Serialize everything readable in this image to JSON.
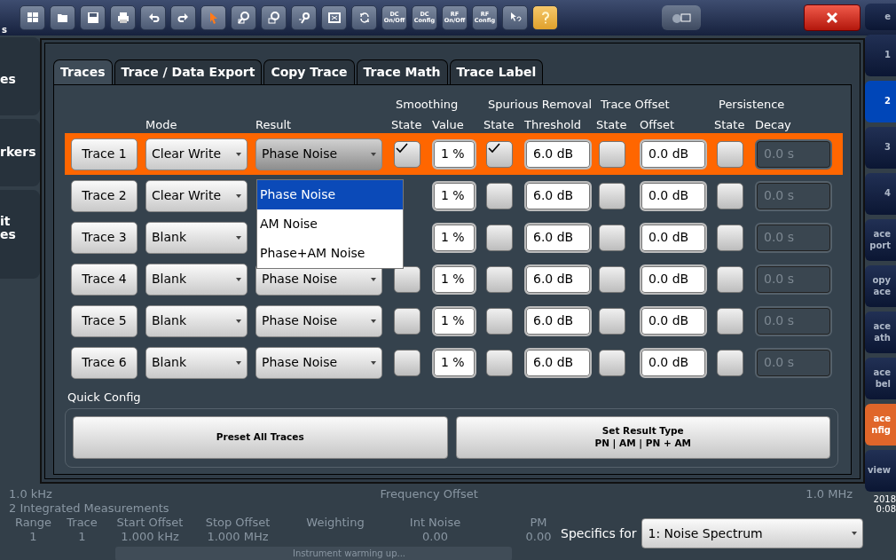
{
  "toolbar": [
    {
      "kind": "windows"
    },
    {
      "kind": "open"
    },
    {
      "kind": "save"
    },
    {
      "kind": "print"
    },
    {
      "kind": "undo"
    },
    {
      "kind": "redo"
    },
    {
      "kind": "pointer"
    },
    {
      "kind": "zoom"
    },
    {
      "kind": "multizoom"
    },
    {
      "kind": "zoomreset"
    },
    {
      "kind": "fullscreen"
    },
    {
      "kind": "split"
    },
    {
      "kind": "text",
      "lines": [
        "DC",
        "On/Off"
      ]
    },
    {
      "kind": "text",
      "lines": [
        "DC",
        "Config"
      ]
    },
    {
      "kind": "text",
      "lines": [
        "RF",
        "On/Off"
      ]
    },
    {
      "kind": "text",
      "lines": [
        "RF",
        "Config"
      ]
    },
    {
      "kind": "helppointer"
    },
    {
      "kind": "help"
    }
  ],
  "background": {
    "corner_text": "s",
    "left_tabs": [
      "es",
      "rkers",
      "it\nes"
    ],
    "softkeys": [
      {
        "label": "e",
        "selected": false
      },
      {
        "label": "1",
        "selected": false
      },
      {
        "label": "2",
        "selected": true
      },
      {
        "label": "3",
        "selected": false
      },
      {
        "label": "4",
        "selected": false
      },
      {
        "label": "ace\nport",
        "selected": false
      },
      {
        "label": "opy\nace",
        "selected": false
      },
      {
        "label": "ace\nath",
        "selected": false
      },
      {
        "label": "ace\nbel",
        "selected": false
      },
      {
        "label": "ace\nnfig",
        "selected": true
      },
      {
        "label": "view",
        "selected": false
      }
    ],
    "axis": {
      "start": "1.0 kHz",
      "title": "Frequency Offset",
      "stop": "1.0 MHz"
    },
    "table_title": "2 Integrated Measurements",
    "table_columns": [
      "Range",
      "Trace",
      "Start Offset",
      "Stop Offset",
      "Weighting",
      "Int Noise",
      "PM"
    ],
    "table_row": {
      "range": "1",
      "trace": "1",
      "start_offset": "1.000 kHz",
      "stop_offset": "1.000 MHz",
      "int_noise": "0.00",
      "pm": "0.00"
    },
    "status": "Instrument warming up...",
    "date": "2018",
    "time": "0:08"
  },
  "dialog": {
    "tabs": [
      {
        "label": "Traces",
        "selected": true
      },
      {
        "label": "Trace / Data Export",
        "selected": false
      },
      {
        "label": "Copy Trace",
        "selected": false
      },
      {
        "label": "Trace Math",
        "selected": false
      },
      {
        "label": "Trace Label",
        "selected": false
      }
    ],
    "groups": [
      "Smoothing",
      "Spurious Removal",
      "Trace Offset",
      "Persistence"
    ],
    "columns": [
      "Mode",
      "Result",
      "State",
      "Value",
      "State",
      "Threshold",
      "State",
      "Offset",
      "State",
      "Decay"
    ],
    "rows": [
      {
        "trace": "Trace 1",
        "selected": true,
        "mode": "Clear Write",
        "result": "Phase Noise",
        "smoothing": true,
        "smoothing_value": "1 %",
        "spurious": true,
        "threshold": "6.0 dB",
        "offset_on": false,
        "offset": "0.0 dB",
        "persistence": false,
        "decay": "0.0 s"
      },
      {
        "trace": "Trace 2",
        "selected": false,
        "mode": "Clear Write",
        "spurious": false,
        "smoothing_value": "1 %",
        "threshold": "6.0 dB",
        "offset_on": false,
        "offset": "0.0 dB",
        "persistence": false,
        "decay": "0.0 s"
      },
      {
        "trace": "Trace 3",
        "selected": false,
        "mode": "Blank",
        "spurious": false,
        "smoothing_value": "1 %",
        "threshold": "6.0 dB",
        "offset_on": false,
        "offset": "0.0 dB",
        "persistence": false,
        "decay": "0.0 s"
      },
      {
        "trace": "Trace 4",
        "selected": false,
        "mode": "Blank",
        "result": "Phase Noise",
        "smoothing": false,
        "smoothing_value": "1 %",
        "spurious": false,
        "threshold": "6.0 dB",
        "offset_on": false,
        "offset": "0.0 dB",
        "persistence": false,
        "decay": "0.0 s"
      },
      {
        "trace": "Trace 5",
        "selected": false,
        "mode": "Blank",
        "result": "Phase Noise",
        "smoothing": false,
        "smoothing_value": "1 %",
        "spurious": false,
        "threshold": "6.0 dB",
        "offset_on": false,
        "offset": "0.0 dB",
        "persistence": false,
        "decay": "0.0 s"
      },
      {
        "trace": "Trace 6",
        "selected": false,
        "mode": "Blank",
        "result": "Phase Noise",
        "smoothing": false,
        "smoothing_value": "1 %",
        "spurious": false,
        "threshold": "6.0 dB",
        "offset_on": false,
        "offset": "0.0 dB",
        "persistence": false,
        "decay": "0.0 s"
      }
    ],
    "result_menu": [
      {
        "label": "Phase Noise",
        "selected": true
      },
      {
        "label": "AM Noise",
        "selected": false
      },
      {
        "label": "Phase+AM Noise",
        "selected": false
      }
    ],
    "quick_config": {
      "title": "Quick Config",
      "buttons": [
        {
          "lines": [
            "Preset All Traces"
          ]
        },
        {
          "lines": [
            "Set Result Type",
            "PN | AM | PN + AM"
          ]
        }
      ]
    }
  },
  "specifics": {
    "label": "Specifics for",
    "value": "1: Noise Spectrum"
  }
}
